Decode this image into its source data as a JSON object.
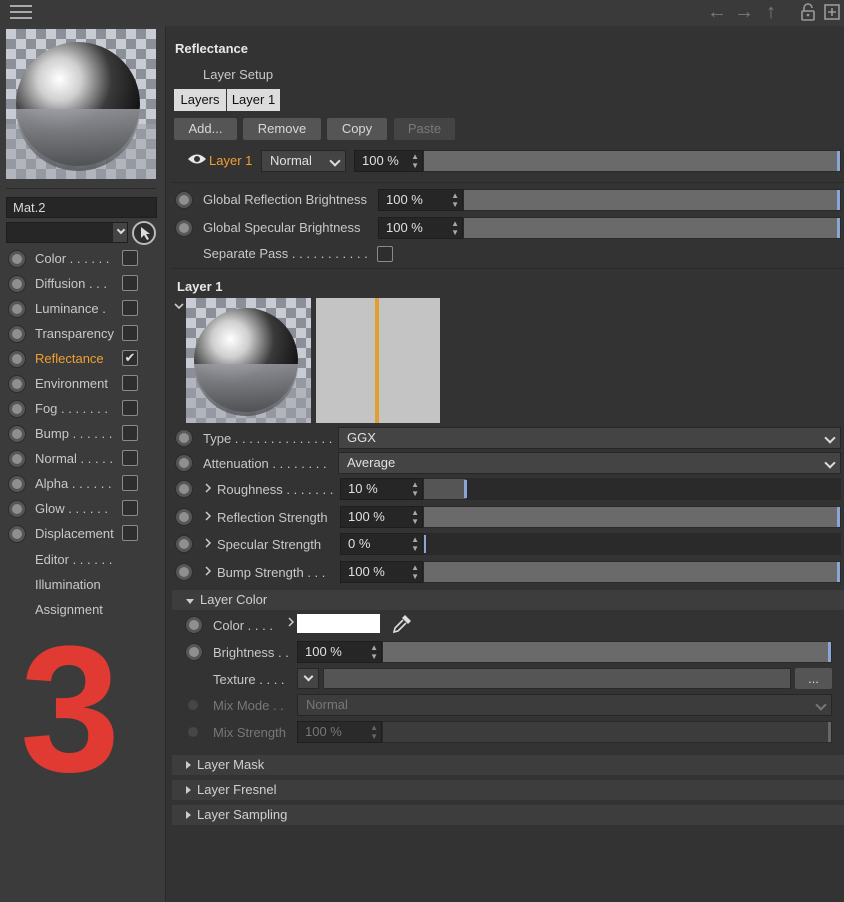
{
  "title": "Reflectance",
  "layer_setup": {
    "label": "Layer Setup",
    "tabs": [
      "Layers",
      "Layer 1"
    ],
    "buttons": {
      "add": "Add...",
      "remove": "Remove",
      "copy": "Copy",
      "paste": "Paste"
    },
    "row": {
      "name": "Layer 1",
      "blend": "Normal",
      "opacity": "100 %",
      "opacity_value": 100
    }
  },
  "global": {
    "refl_label": "Global Reflection Brightness",
    "refl_value": "100 %",
    "spec_label": "Global Specular Brightness",
    "spec_value": "100 %",
    "sep_label": "Separate Pass . . . . . . . . . . ."
  },
  "layer1": {
    "title": "Layer 1",
    "type_label": "Type . . . . . . . . . . . . . .",
    "type_value": "GGX",
    "att_label": "Attenuation . . . . . . . .",
    "att_value": "Average",
    "rough_label": "Roughness . . . . . . .",
    "rough_value": "10 %",
    "rough_fill": 0.1,
    "reflstr_label": "Reflection Strength",
    "reflstr_value": "100 %",
    "specstr_label": "Specular Strength",
    "specstr_value": "0 %",
    "bump_label": "Bump Strength . . .",
    "bump_value": "100 %"
  },
  "layer_color": {
    "section": "Layer Color",
    "color_label": "Color . . . .",
    "color_hex": "#ffffff",
    "bright_label": "Brightness . .",
    "bright_value": "100 %",
    "texture_label": "Texture . . . .",
    "texture_btn": "...",
    "mix_label": "Mix Mode . .",
    "mix_value": "Normal",
    "mixstr_label": "Mix Strength",
    "mixstr_value": "100 %"
  },
  "sections": {
    "mask": "Layer Mask",
    "fresnel": "Layer Fresnel",
    "sampling": "Layer Sampling"
  },
  "sidebar": {
    "material_name": "Mat.2",
    "channels": [
      {
        "label": "Color . . . . . .",
        "checked": false
      },
      {
        "label": "Diffusion . . .",
        "checked": false
      },
      {
        "label": "Luminance  .",
        "checked": false
      },
      {
        "label": "Transparency",
        "checked": false
      },
      {
        "label": "Reflectance",
        "checked": true
      },
      {
        "label": "Environment",
        "checked": false
      },
      {
        "label": "Fog  . . . . . . .",
        "checked": false
      },
      {
        "label": "Bump . . . . . .",
        "checked": false
      },
      {
        "label": "Normal . . . . .",
        "checked": false
      },
      {
        "label": "Alpha  . . . . . .",
        "checked": false
      },
      {
        "label": "Glow  . . . . . .",
        "checked": false
      },
      {
        "label": "Displacement",
        "checked": false
      }
    ],
    "extras": [
      "Editor . . . . . .",
      "Illumination",
      "Assignment"
    ],
    "annotation": "3",
    "accent": "#f0a030",
    "annotation_color": "#e03a33"
  }
}
